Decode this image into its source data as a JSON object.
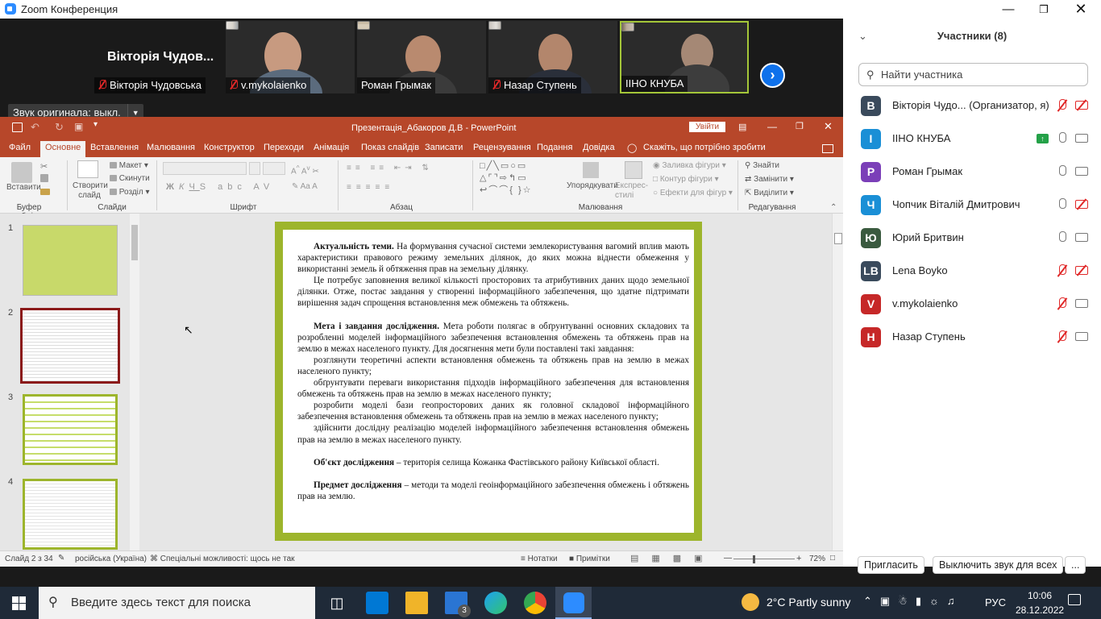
{
  "zoom": {
    "window_title": "Zoom Конференция",
    "gallery": {
      "tiles": [
        {
          "display": "Вікторія Чудов...",
          "name": "Вікторія Чудовська",
          "muted": true
        },
        {
          "name": "v.mykolaienko",
          "muted": true
        },
        {
          "name": "Роман Грымак",
          "muted": false
        },
        {
          "name": "Назар Ступень",
          "muted": true
        },
        {
          "name": "ІІНО КНУБА",
          "muted": false
        }
      ],
      "next_icon": "chevron-right-icon"
    },
    "original_sound_button": "Звук оригинала: выкл."
  },
  "ppt": {
    "title": "Презентація_Абакоров Д.В  -  PowerPoint",
    "signin": "Увійти",
    "tabs": [
      "Файл",
      "Основне",
      "Вставлення",
      "Малювання",
      "Конструктор",
      "Переходи",
      "Анімація",
      "Показ слайдів",
      "Записати",
      "Рецензування",
      "Подання",
      "Довідка"
    ],
    "active_tab": "Основне",
    "tell_me": "Скажіть, що потрібно зробити",
    "ribbon": {
      "paste": "Вставити",
      "new_slide": "Створити слайд",
      "layout": "Макет",
      "reset": "Скинути",
      "section": "Розділ",
      "arrange": "Упорядкувати",
      "quick_styles": "Експрес-стилі",
      "shape_fill": "Заливка фігури",
      "shape_outline": "Контур фігури",
      "shape_effects": "Ефекти для фігур",
      "find": "Знайти",
      "replace": "Замінити",
      "select": "Виділити",
      "groups": [
        "Буфер обміну",
        "Слайди",
        "Шрифт",
        "Абзац",
        "Малювання",
        "Редагування"
      ]
    },
    "thumbnails": [
      "1",
      "2",
      "3",
      "4"
    ],
    "slide": {
      "p1_bold": "Актуальність теми.",
      "p1": " На формування сучасної системи землекористування вагомий вплив мають характеристики правового режиму земельних ділянок, до яких можна віднести обмеження у використанні земель й обтяження прав на земельну ділянку.",
      "p2": "Це потребує заповнення великої кількості просторових та атрибутивних даних щодо земельної ділянки. Отже, постає завдання у створенні інформаційного забезпечення, що здатне підтримати вирішення задач спрощення встановлення меж обмежень та обтяжень.",
      "p3_bold": "Мета і завдання дослідження.",
      "p3": " Мета роботи полягає в обґрунтуванні основних складових та розробленні моделей інформаційного забезпечення встановлення обмежень та обтяжень прав на землю в межах населеного пункту. Для досягнення мети були поставлені такі завдання:",
      "t1": "розглянути теоретичні аспекти встановлення обмежень та обтяжень прав на землю в межах населеного пункту;",
      "t2": "обґрунтувати переваги використання підходів інформаційного забезпечення для встановлення обмежень та обтяжень прав на землю в межах населеного пункту;",
      "t3": "розробити моделі бази геопросторових даних як головної складової інформаційного забезпечення встановлення обмежень та обтяжень прав на землю в межах населеного пункту;",
      "t4": "здійснити дослідну реалізацію моделей інформаційного забезпечення встановлення обмежень прав на землю в межах населеного пункту.",
      "p4_bold": "Об'єкт дослідження",
      "p4": " – територія селища Кожанка Фастівського району Київської області.",
      "p5_bold": "Предмет дослідження",
      "p5": " – методи та моделі геоінформаційного забезпечення обмежень і обтяжень прав на землю."
    },
    "status": {
      "slide_of": "Слайд 2 з 34",
      "language": "російська (Україна)",
      "accessibility": "Спеціальні можливості: щось не так",
      "notes": "Нотатки",
      "comments": "Примітки",
      "zoom": "72%"
    }
  },
  "participants": {
    "title": "Участники (8)",
    "search_placeholder": "Найти участника",
    "list": [
      {
        "initial": "В",
        "color": "#3a4a5c",
        "name": "Вікторія Чудо...   (Организатор, я)",
        "mic_off": true,
        "cam_off": true,
        "sharing": false
      },
      {
        "initial": "І",
        "color": "#1a8fd6",
        "name": "ІІНО КНУБА",
        "mic_off": false,
        "cam_off": false,
        "sharing": true
      },
      {
        "initial": "Р",
        "color": "#7b3fb8",
        "name": "Роман Грымак",
        "mic_off": false,
        "cam_off": false,
        "sharing": false
      },
      {
        "initial": "Ч",
        "color": "#1a8fd6",
        "name": "Чопчик Віталій Дмитрович",
        "mic_off": false,
        "cam_off": true,
        "sharing": false
      },
      {
        "initial": "Ю",
        "color": "#3a5a3f",
        "name": "Юрий Бритвин",
        "mic_off": false,
        "cam_off": false,
        "sharing": false
      },
      {
        "initial": "LB",
        "color": "#3a4a5c",
        "name": "Lena Boyko",
        "mic_off": true,
        "cam_off": true,
        "sharing": false
      },
      {
        "initial": "V",
        "color": "#c62828",
        "name": "v.mykolaienko",
        "mic_off": true,
        "cam_off": false,
        "sharing": false
      },
      {
        "initial": "Н",
        "color": "#c62828",
        "name": "Назар Ступень",
        "mic_off": true,
        "cam_off": false,
        "sharing": false
      }
    ],
    "invite": "Пригласить",
    "mute_all": "Выключить звук для всех",
    "more": "..."
  },
  "taskbar": {
    "search": "Введите здесь текст для поиска",
    "mail_badge": "3",
    "weather": "2°C  Partly sunny",
    "lang": "РУС",
    "time": "10:06",
    "date": "28.12.2022"
  }
}
